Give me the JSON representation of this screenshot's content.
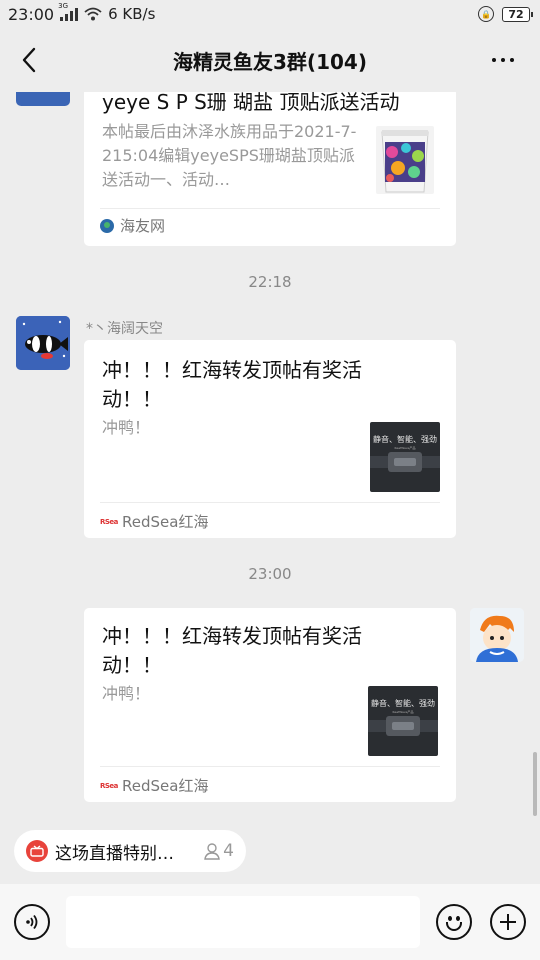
{
  "status_bar": {
    "time": "23:00",
    "signal_label": "3G",
    "net_speed": "6 KB/s",
    "battery": "72"
  },
  "header": {
    "title": "海精灵鱼友3群(104)"
  },
  "messages": [
    {
      "type": "link_card",
      "title": "yeye S P S珊 瑚盐 顶贴派送活动",
      "desc": "本帖最后由沐泽水族用品于2021-7-215:04编辑yeyeSPS珊瑚盐顶贴派送活动一、活动…",
      "source": "海友网",
      "thumb_icon": "salt-bucket-image"
    },
    {
      "type": "timestamp",
      "text": "22:18"
    },
    {
      "type": "link_card",
      "sender": "*丶海阔天空",
      "title": "冲！！！红海转发顶帖有奖活动！！",
      "desc": "冲鸭！",
      "source": "RedSea红海",
      "thumb_text": "静音、智能、强劲",
      "thumb_sub": "ReefWave产品"
    },
    {
      "type": "timestamp",
      "text": "23:00"
    },
    {
      "type": "link_card",
      "self": true,
      "title": "冲！！！红海转发顶帖有奖活动！！",
      "desc": "冲鸭！",
      "source": "RedSea红海",
      "thumb_text": "静音、智能、强劲",
      "thumb_sub": "ReefWave产品"
    }
  ],
  "live": {
    "text": "这场直播特别…",
    "viewers": "4"
  },
  "input": {
    "placeholder": ""
  },
  "icons": {
    "back": "back-arrow-icon",
    "more": "more-dots-icon",
    "voice": "voice-icon",
    "emoji": "emoji-icon",
    "plus": "plus-icon",
    "live": "live-tv-icon",
    "viewer": "person-icon"
  },
  "colors": {
    "background": "#ededed",
    "card": "#ffffff",
    "live_red": "#e8433b"
  }
}
